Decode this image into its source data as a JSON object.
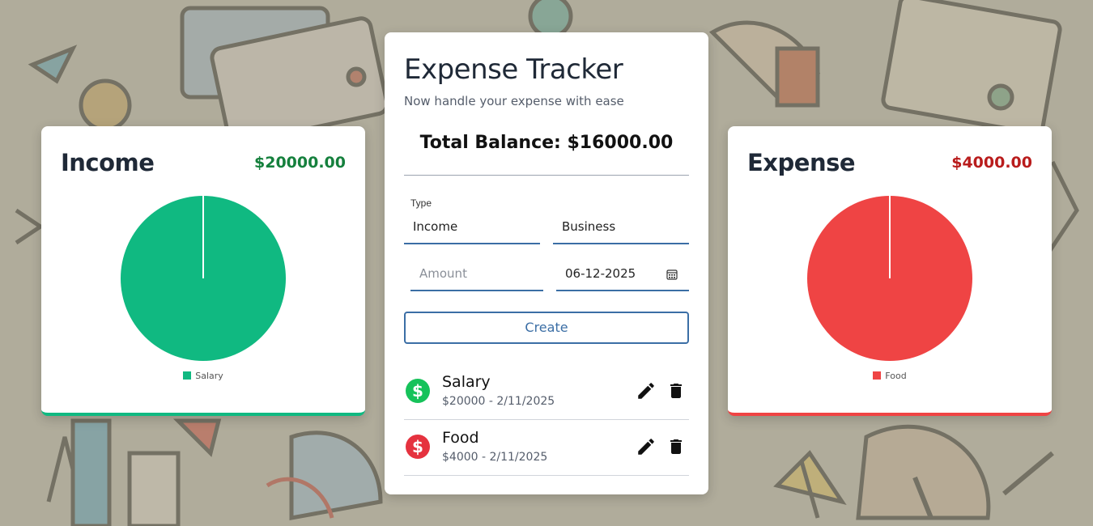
{
  "app": {
    "title": "Expense Tracker",
    "subtitle": "Now handle your expense with ease",
    "total_balance": "Total Balance: $16000.00"
  },
  "income_card": {
    "title": "Income",
    "amount": "$20000.00",
    "color": "#10b981",
    "amount_color": "#15803d",
    "legend": [
      {
        "label": "Salary",
        "color": "#10b981"
      }
    ]
  },
  "expense_card": {
    "title": "Expense",
    "amount": "$4000.00",
    "color": "#ef4444",
    "amount_color": "#b91c1c",
    "legend": [
      {
        "label": "Food",
        "color": "#ef4444"
      }
    ]
  },
  "form": {
    "type_label": "Type",
    "type_value": "Income",
    "category_value": "Business",
    "amount_placeholder": "Amount",
    "date_value": "06-12-2025",
    "create_label": "Create"
  },
  "transactions": [
    {
      "name": "Salary",
      "detail": "$20000 - 2/11/2025",
      "kind": "income",
      "icon": "dollar-circle-icon",
      "color": "#16c25a"
    },
    {
      "name": "Food",
      "detail": "$4000 - 2/11/2025",
      "kind": "expense",
      "icon": "dollar-circle-icon",
      "color": "#e5323f"
    }
  ],
  "chart_data": [
    {
      "type": "pie",
      "title": "Income",
      "categories": [
        "Salary"
      ],
      "values": [
        20000
      ],
      "colors": [
        "#10b981"
      ],
      "legend": "bottom"
    },
    {
      "type": "pie",
      "title": "Expense",
      "categories": [
        "Food"
      ],
      "values": [
        4000
      ],
      "colors": [
        "#ef4444"
      ],
      "legend": "bottom"
    }
  ]
}
